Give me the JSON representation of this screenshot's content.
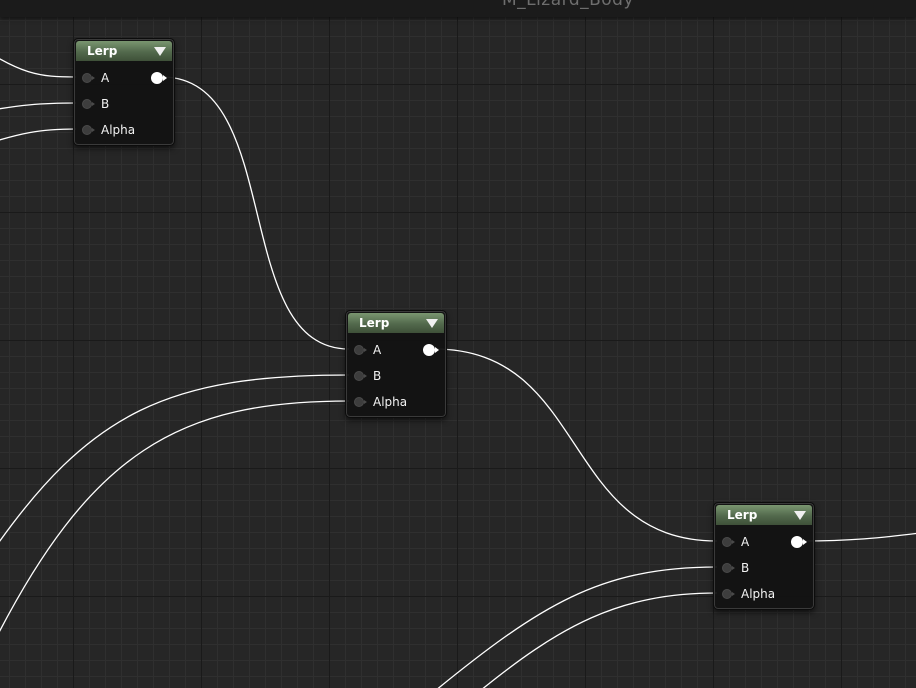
{
  "graph": {
    "title": "M_Lizard_Body"
  },
  "nodes": [
    {
      "title": "Lerp",
      "inputs": [
        {
          "label": "A"
        },
        {
          "label": "B"
        },
        {
          "label": "Alpha"
        }
      ]
    },
    {
      "title": "Lerp",
      "inputs": [
        {
          "label": "A"
        },
        {
          "label": "B"
        },
        {
          "label": "Alpha"
        }
      ]
    },
    {
      "title": "Lerp",
      "inputs": [
        {
          "label": "A"
        },
        {
          "label": "B"
        },
        {
          "label": "Alpha"
        }
      ]
    }
  ],
  "colors": {
    "background": "#262626",
    "header_green": "#5d7a55",
    "wire": "#ffffff"
  }
}
